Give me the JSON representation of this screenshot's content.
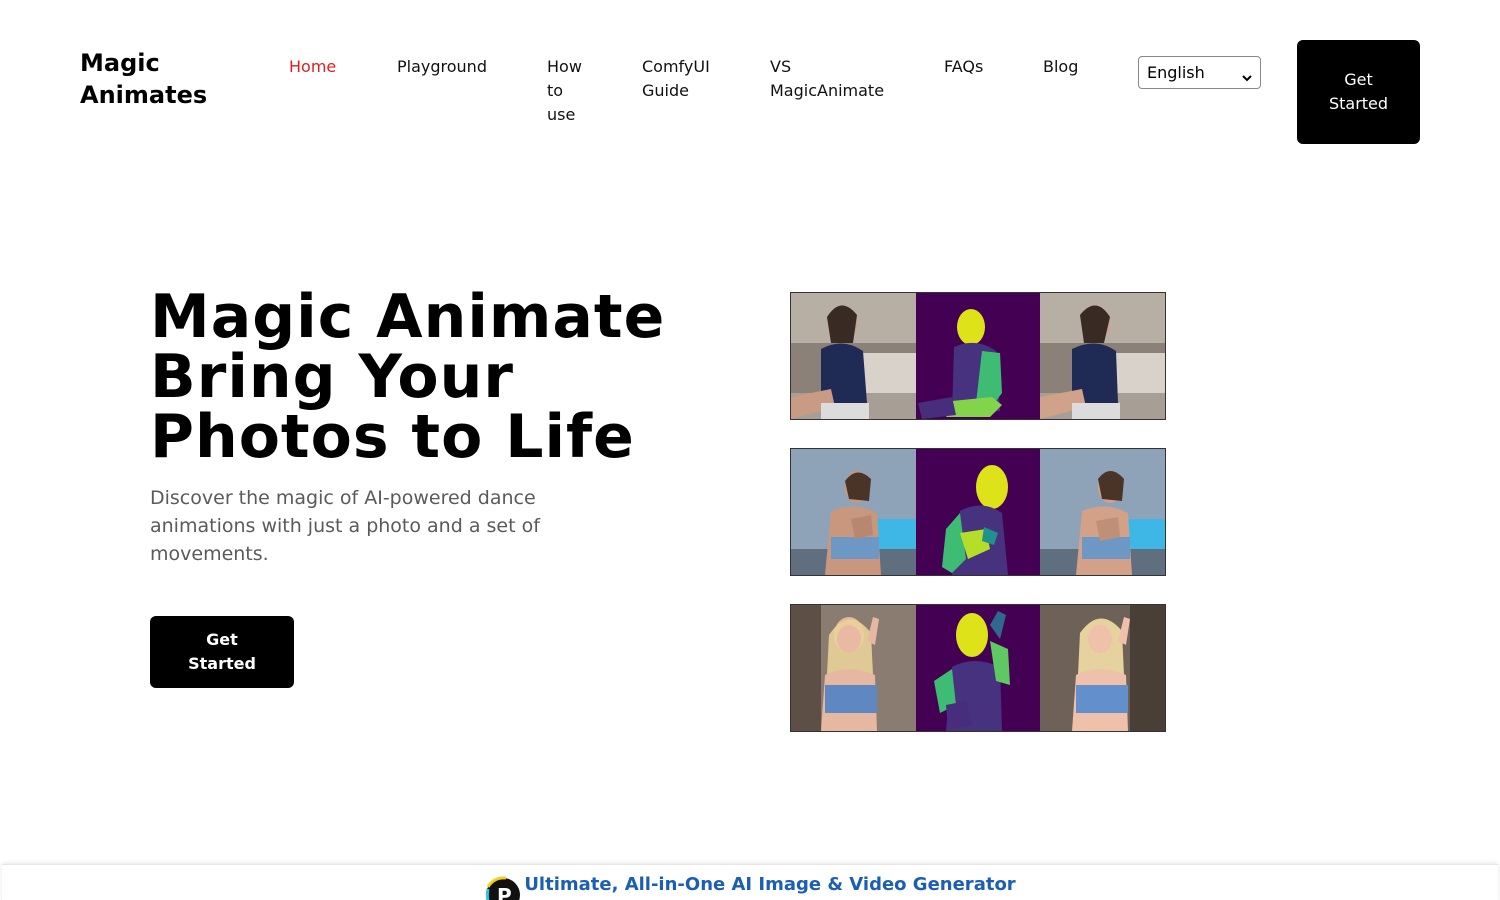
{
  "header": {
    "brand": "Magic Animates",
    "nav": [
      {
        "label": "Home",
        "active": true
      },
      {
        "label": "Playground"
      },
      {
        "label": "How to use"
      },
      {
        "label": "ComfyUI Guide"
      },
      {
        "label": "VS MagicAnimate"
      },
      {
        "label": "FAQs"
      },
      {
        "label": "Blog"
      }
    ],
    "language": {
      "selected": "English"
    },
    "cta_label": "Get Started"
  },
  "hero": {
    "title_line1": "Magic Animate",
    "title_line2": "Bring Your",
    "title_line3": "Photos to Life",
    "subtitle": "Discover the magic of AI-powered dance animations with just a photo and a set of movements.",
    "cta_label": "Get Started"
  },
  "demos": [
    {
      "reference": "dancer photo",
      "pose": "densepose map",
      "result": "animated frame"
    },
    {
      "reference": "dancer photo",
      "pose": "densepose map",
      "result": "animated frame"
    },
    {
      "reference": "dancer photo",
      "pose": "densepose map",
      "result": "animated frame"
    }
  ],
  "banner": {
    "text": "Ultimate, All-in-One AI Image & Video Generator",
    "logo_icon": "p-logo-icon"
  },
  "colors": {
    "active_nav": "#e11d1d",
    "button_bg": "#000000",
    "pose_bg": "#440154",
    "banner_text": "#1a5fb4"
  }
}
